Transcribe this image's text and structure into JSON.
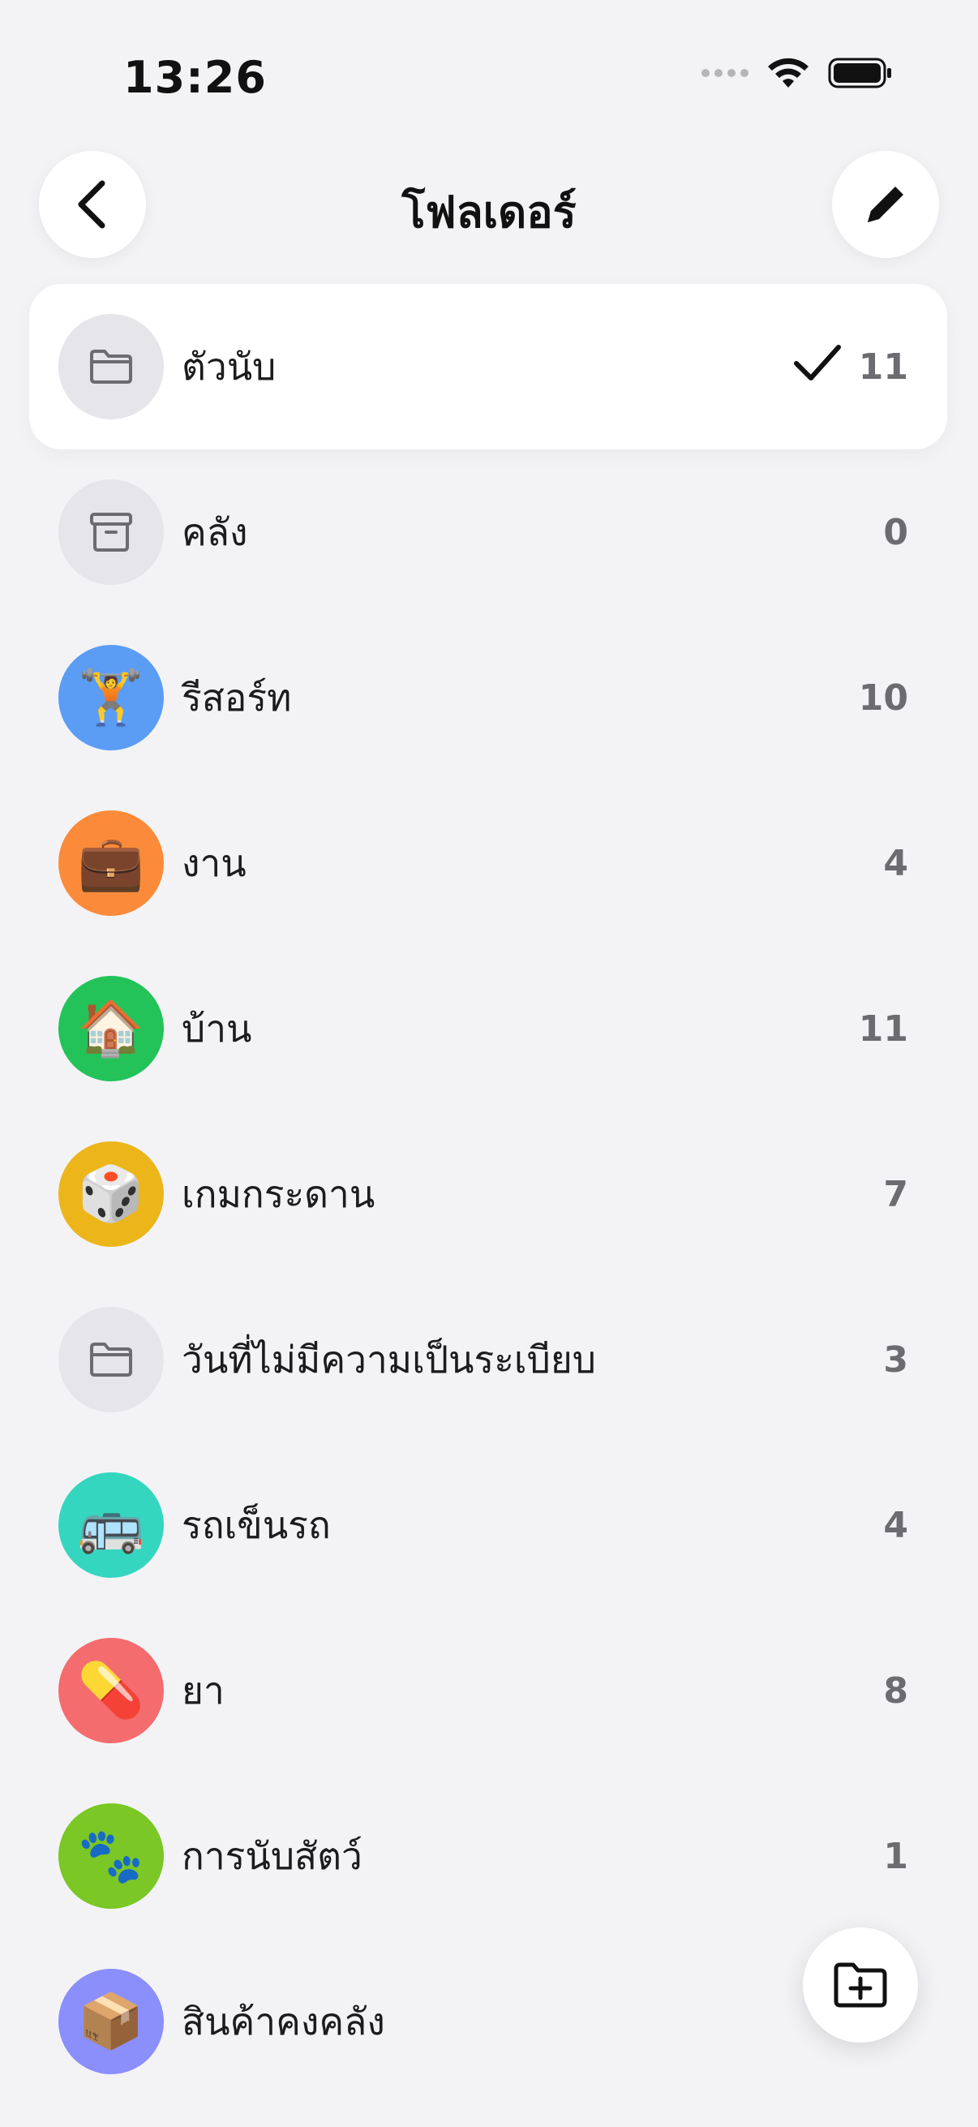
{
  "status_bar": {
    "time": "13:26"
  },
  "header": {
    "title": "โฟลเดอร์",
    "back_icon": "chevron-left-icon",
    "edit_icon": "pencil-icon"
  },
  "folders": [
    {
      "name": "ตัวนับ",
      "count": "11",
      "icon": "folder-icon",
      "color": "#e5e5ea",
      "selected": true
    },
    {
      "name": "คลัง",
      "count": "0",
      "icon": "archive-box-icon",
      "color": "#e5e5ea",
      "selected": false
    },
    {
      "name": "รีสอร์ท",
      "count": "10",
      "icon": "🏋️",
      "color": "#5b9cf5",
      "selected": false
    },
    {
      "name": "งาน",
      "count": "4",
      "icon": "💼",
      "color": "#fb8b3a",
      "selected": false
    },
    {
      "name": "บ้าน",
      "count": "11",
      "icon": "🏠",
      "color": "#23c35a",
      "selected": false
    },
    {
      "name": "เกมกระดาน",
      "count": "7",
      "icon": "🎲",
      "color": "#ecb61a",
      "selected": false
    },
    {
      "name": "วันที่ไม่มีความเป็นระเบียบ",
      "count": "3",
      "icon": "folder-icon",
      "color": "#e5e5ea",
      "selected": false
    },
    {
      "name": "รถเข็นรถ",
      "count": "4",
      "icon": "🚌",
      "color": "#35d6bf",
      "selected": false
    },
    {
      "name": "ยา",
      "count": "8",
      "icon": "💊",
      "color": "#f46c6e",
      "selected": false
    },
    {
      "name": "การนับสัตว์",
      "count": "1",
      "icon": "🐾",
      "color": "#7ac725",
      "selected": false
    },
    {
      "name": "สินค้าคงคลัง",
      "count": "",
      "icon": "📦",
      "color": "#8b8ffb",
      "selected": false
    }
  ],
  "fab": {
    "icon": "folder-plus-icon"
  }
}
